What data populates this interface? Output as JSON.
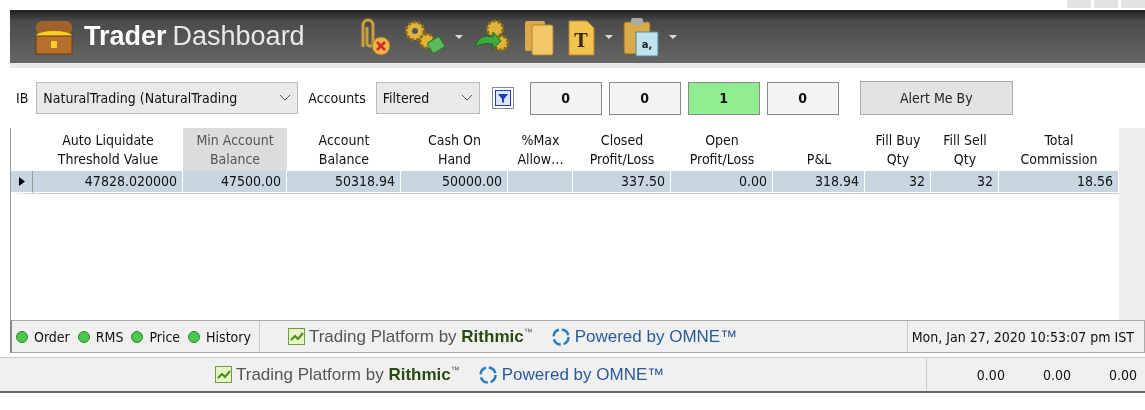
{
  "window": {
    "title_bold": "Trader",
    "title_light": "Dashboard"
  },
  "toolbar_icons": [
    {
      "kind": "clip",
      "dropdown": false
    },
    {
      "kind": "gears",
      "dropdown": true
    },
    {
      "kind": "gears-arrow",
      "dropdown": false
    },
    {
      "kind": "folders",
      "dropdown": false
    },
    {
      "kind": "doc",
      "glyph": "T",
      "dropdown": true
    },
    {
      "kind": "clipboard",
      "glyph": "a,",
      "dropdown": true
    }
  ],
  "filters": {
    "ib_label": "IB",
    "ib_value": "NaturalTrading (NaturalTrading",
    "accounts_label": "Accounts",
    "accounts_value": "Filtered",
    "counters": [
      {
        "value": "0",
        "highlighted": false
      },
      {
        "value": "0",
        "highlighted": false
      },
      {
        "value": "1",
        "highlighted": true
      },
      {
        "value": "0",
        "highlighted": false
      }
    ],
    "alert_button": "Alert Me By"
  },
  "table": {
    "columns": [
      {
        "label": "Auto Liquidate\nThreshold Value",
        "sorted": false
      },
      {
        "label": "Min Account\nBalance",
        "sorted": true
      },
      {
        "label": "Account\nBalance",
        "sorted": false
      },
      {
        "label": "Cash On\nHand",
        "sorted": false
      },
      {
        "label": "%Max\nAllow…",
        "sorted": false
      },
      {
        "label": "Closed\nProfit/Loss",
        "sorted": false
      },
      {
        "label": "Open\nProfit/Loss",
        "sorted": false
      },
      {
        "label": "P&L",
        "sorted": false
      },
      {
        "label": "Fill Buy\nQty",
        "sorted": false
      },
      {
        "label": "Fill Sell\nQty",
        "sorted": false
      },
      {
        "label": "Total\nCommission",
        "sorted": false
      }
    ],
    "rows": [
      {
        "selected": true,
        "cells": [
          "47828.020000",
          "47500.00",
          "50318.94",
          "50000.00",
          "",
          "337.50",
          "0.00",
          "318.94",
          "32",
          "32",
          "18.56"
        ]
      }
    ]
  },
  "status_bar": {
    "indicators": [
      {
        "label": "Order",
        "on": true
      },
      {
        "label": "RMS",
        "on": true
      },
      {
        "label": "Price",
        "on": true
      },
      {
        "label": "History",
        "on": true
      }
    ],
    "platform_text": "Trading Platform by",
    "platform_brand": "Rithmic",
    "platform_mark": "™",
    "powered_text": "Powered by OMNE™",
    "datetime": "Mon, Jan 27, 2020 10:53:07 pm IST"
  },
  "bottom_bar": {
    "platform_text": "Trading Platform by",
    "platform_brand": "Rithmic",
    "platform_mark": "™",
    "powered_text": "Powered by OMNE™",
    "values": [
      "0.00",
      "0.00",
      "0.00"
    ]
  }
}
